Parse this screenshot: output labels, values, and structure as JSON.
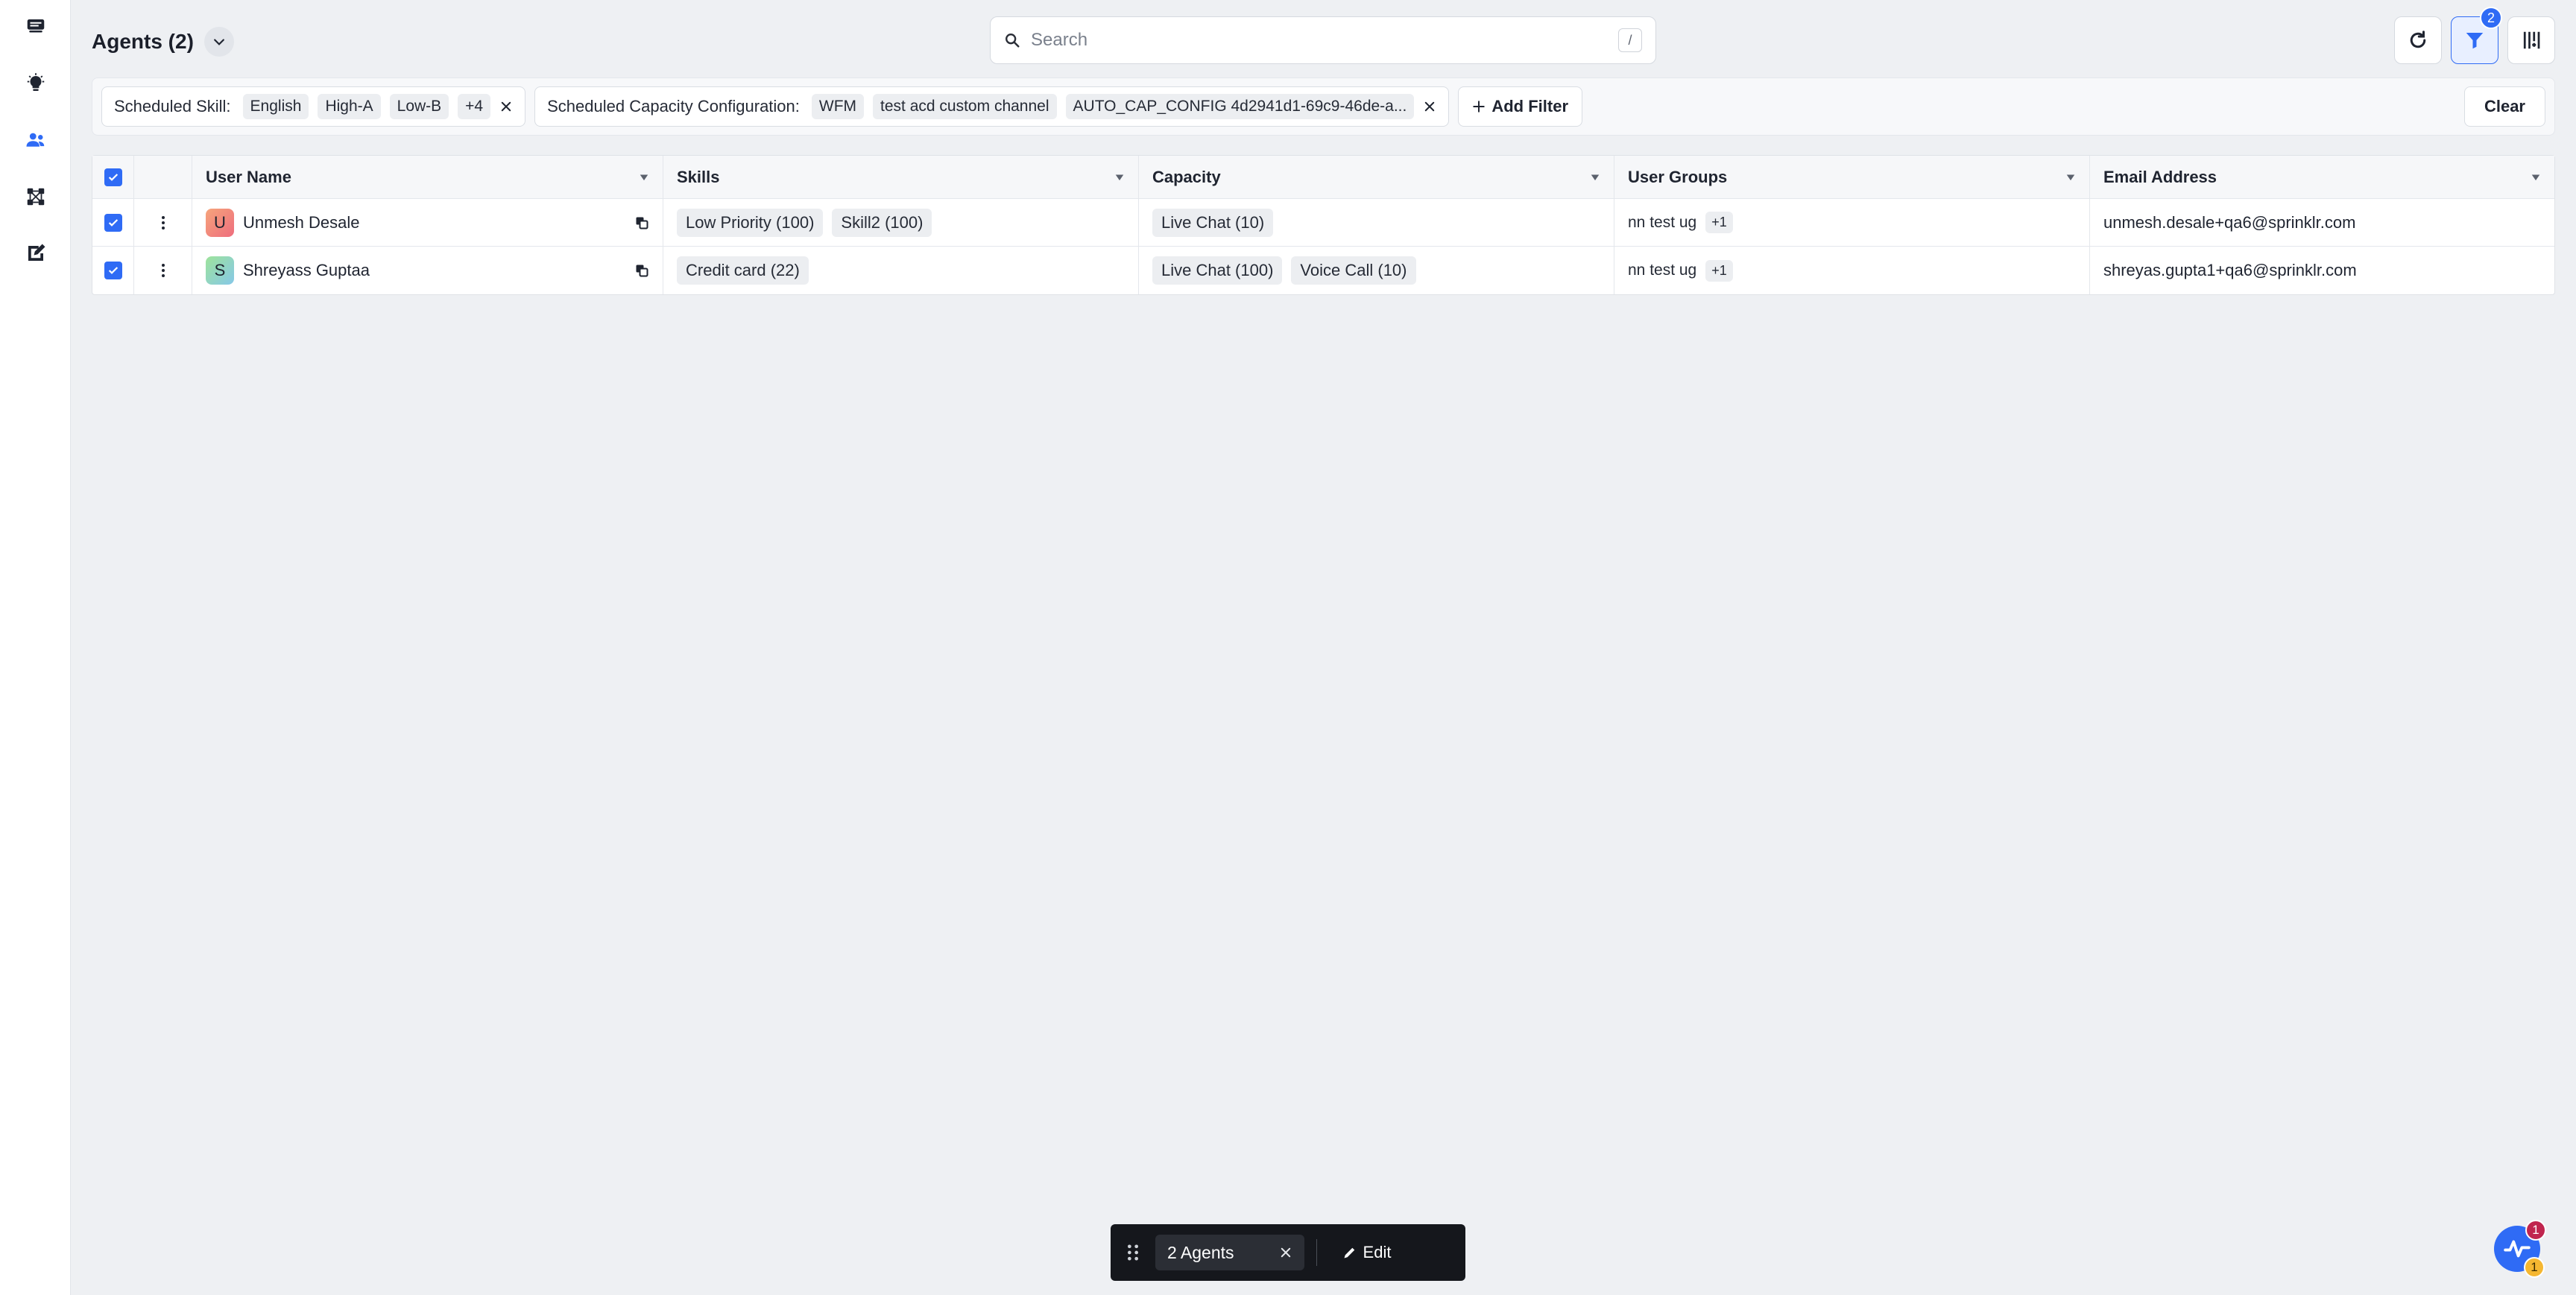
{
  "header": {
    "title": "Agents (2)"
  },
  "search": {
    "placeholder": "Search",
    "shortcut": "/"
  },
  "top_actions": {
    "filter_count": "2"
  },
  "filters": {
    "skill": {
      "label": "Scheduled Skill:",
      "chips": [
        "English",
        "High-A",
        "Low-B",
        "+4"
      ]
    },
    "capacity": {
      "label": "Scheduled Capacity Configuration:",
      "chips": [
        "WFM",
        "test acd custom channel",
        "AUTO_CAP_CONFIG 4d2941d1-69c9-46de-a..."
      ]
    },
    "add_filter": "Add Filter",
    "clear": "Clear"
  },
  "table": {
    "columns": {
      "user_name": "User Name",
      "skills": "Skills",
      "capacity": "Capacity",
      "user_groups": "User Groups",
      "email": "Email Address"
    },
    "rows": [
      {
        "initial": "U",
        "name": "Unmesh Desale",
        "skills": [
          "Low Priority (100)",
          "Skill2 (100)"
        ],
        "capacity": [
          "Live Chat (10)"
        ],
        "group": "nn test ug",
        "group_more": "+1",
        "email": "unmesh.desale+qa6@sprinklr.com"
      },
      {
        "initial": "S",
        "name": "Shreyass Guptaa",
        "skills": [
          "Credit card (22)"
        ],
        "capacity": [
          "Live Chat (100)",
          "Voice Call (10)"
        ],
        "group": "nn test ug",
        "group_more": "+1",
        "email": "shreyas.gupta1+qa6@sprinklr.com"
      }
    ]
  },
  "action_bar": {
    "selection": "2 Agents",
    "edit": "Edit"
  },
  "fab": {
    "badge_top": "1",
    "badge_bottom": "1"
  },
  "colors": {
    "accent": "#2f6bf5",
    "background": "#eef0f3"
  }
}
